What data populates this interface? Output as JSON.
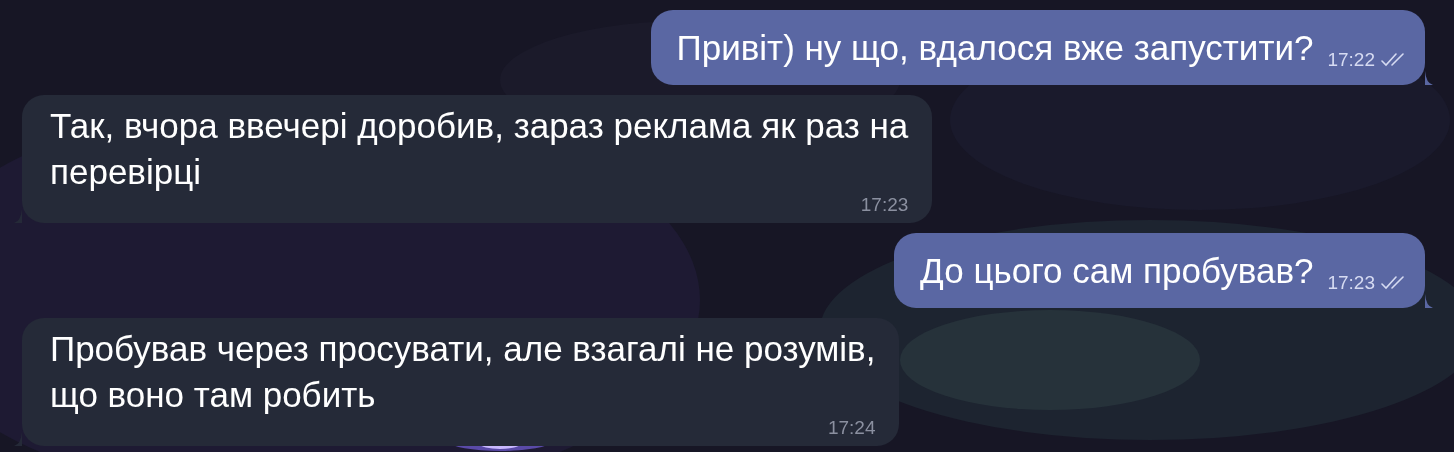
{
  "messages": [
    {
      "kind": "outgoing",
      "text": "Привіт) ну що, вдалося вже запустити?",
      "time": "17:22",
      "read": true
    },
    {
      "kind": "incoming",
      "text": "Так, вчора ввечері доробив, зараз реклама як раз на\nперевірці",
      "time": "17:23"
    },
    {
      "kind": "outgoing",
      "text": "До цього сам пробував?",
      "time": "17:23",
      "read": true
    },
    {
      "kind": "incoming",
      "text": "Пробував через просувати, але взагалі не розумів,\nщо воно там робить",
      "time": "17:24"
    }
  ]
}
